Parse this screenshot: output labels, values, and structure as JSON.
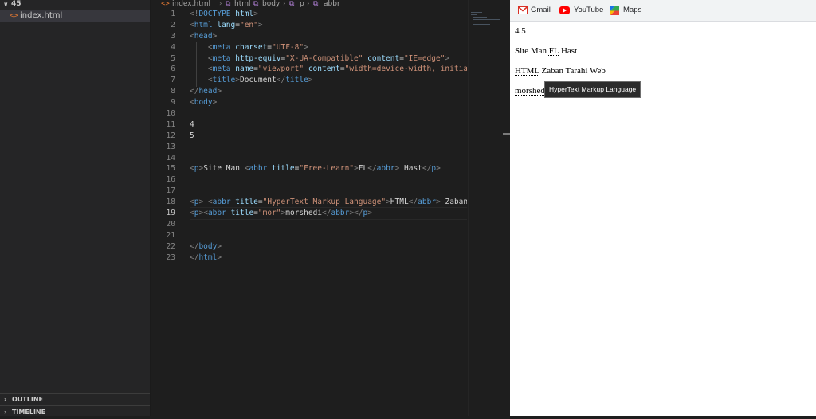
{
  "sidebar": {
    "folder": "45",
    "file": "index.html",
    "panels": {
      "outline": "OUTLINE",
      "timeline": "TIMELINE"
    }
  },
  "breadcrumb": {
    "file": "index.html",
    "path": [
      "html",
      "body",
      "p",
      "abbr"
    ]
  },
  "editor": {
    "active_line": 19,
    "line_numbers": [
      "1",
      "2",
      "3",
      "4",
      "5",
      "6",
      "7",
      "8",
      "9",
      "10",
      "11",
      "12",
      "13",
      "14",
      "15",
      "16",
      "17",
      "18",
      "19",
      "20",
      "21",
      "22",
      "23"
    ],
    "lines": [
      "<!DOCTYPE html>",
      "<html lang=\"en\">",
      "<head>",
      "    <meta charset=\"UTF-8\">",
      "    <meta http-equiv=\"X-UA-Compatible\" content=\"IE=edge\">",
      "    <meta name=\"viewport\" content=\"width=device-width, initial",
      "    <title>Document</title>",
      "</head>",
      "<body>",
      "",
      "4",
      "5",
      "",
      "",
      "<p>Site Man <abbr title=\"Free-Learn\">FL</abbr> Hast</p>",
      "",
      "",
      "<p> <abbr title=\"HyperText Markup Language\">HTML</abbr> Zaban",
      "<p><abbr title=\"mor\">morshedi</abbr></p>",
      "",
      "",
      "</body>",
      "</html>"
    ]
  },
  "browser": {
    "bookmarks": [
      {
        "label": "Gmail",
        "icon": "gmail-icon"
      },
      {
        "label": "YouTube",
        "icon": "youtube-icon"
      },
      {
        "label": "Maps",
        "icon": "maps-icon"
      }
    ],
    "content": {
      "line1": "4 5",
      "line2_pre": "Site Man ",
      "line2_abbr": "FL",
      "line2_post": " Hast",
      "line3_abbr": "HTML",
      "line3_post": " Zaban Tarahi Web",
      "line4_abbr": "morshedi"
    },
    "tooltip": "HyperText Markup Language"
  },
  "colors": {
    "editor_bg": "#1e1e1e",
    "sidebar_bg": "#252526",
    "tag": "#569cd6",
    "attribute": "#9cdcfe",
    "string": "#ce9178",
    "html_file_icon": "#e37933"
  }
}
